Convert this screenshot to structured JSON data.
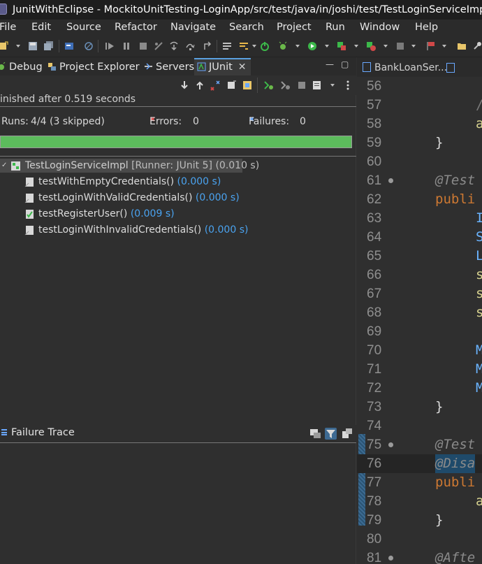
{
  "window": {
    "title": "JunitWithEclipse - MockitoUnitTesting-LoginApp/src/test/java/in/joshi/test/TestLoginServiceImpl.java -"
  },
  "menu": [
    "File",
    "Edit",
    "Source",
    "Refactor",
    "Navigate",
    "Search",
    "Project",
    "Run",
    "Window",
    "Help"
  ],
  "views": {
    "tabs": [
      {
        "label": "Debug",
        "icon": "debug-icon"
      },
      {
        "label": "Project Explorer",
        "icon": "project-explorer-icon"
      },
      {
        "label": "Servers",
        "icon": "servers-icon"
      },
      {
        "label": "JUnit",
        "icon": "junit-icon",
        "active": true
      }
    ]
  },
  "junit": {
    "status": "inished after 0.519 seconds",
    "runs_label": "Runs:",
    "runs_value": "4/4 (3 skipped)",
    "errors_label": "Errors:",
    "errors_value": "0",
    "failures_label": "Failures:",
    "failures_value": "0",
    "progress": 1.0,
    "progress_color": "#5cbb5c",
    "root": {
      "name": "TestLoginServiceImpl",
      "runner": "[Runner: JUnit 5] (0.010 s)"
    },
    "tests": [
      {
        "name": "testWithEmptyCredentials()",
        "time": "(0.000 s)",
        "status": "skipped"
      },
      {
        "name": "testLoginWithValidCredentials()",
        "time": "(0.000 s)",
        "status": "skipped"
      },
      {
        "name": "testRegisterUser()",
        "time": "(0.009 s)",
        "status": "passed"
      },
      {
        "name": "testLoginWithInvalidCredentials()",
        "time": "(0.000 s)",
        "status": "skipped"
      }
    ],
    "failure_trace_title": "Failure Trace"
  },
  "editor": {
    "tab_label": "BankLoanSer...",
    "lines": [
      {
        "n": "56",
        "code": ""
      },
      {
        "n": "57",
        "code": "/"
      },
      {
        "n": "58",
        "code": "a"
      },
      {
        "n": "59",
        "code": "}"
      },
      {
        "n": "60",
        "code": ""
      },
      {
        "n": "61",
        "code": "@Test",
        "bp": true
      },
      {
        "n": "62",
        "code": "publi"
      },
      {
        "n": "63",
        "code": "I"
      },
      {
        "n": "64",
        "code": "S"
      },
      {
        "n": "65",
        "code": "L"
      },
      {
        "n": "66",
        "code": "s"
      },
      {
        "n": "67",
        "code": "s"
      },
      {
        "n": "68",
        "code": "s"
      },
      {
        "n": "69",
        "code": ""
      },
      {
        "n": "70",
        "code": "M"
      },
      {
        "n": "71",
        "code": "M"
      },
      {
        "n": "72",
        "code": "M"
      },
      {
        "n": "73",
        "code": "}"
      },
      {
        "n": "74",
        "code": ""
      },
      {
        "n": "75",
        "code": "@Test",
        "bp": true
      },
      {
        "n": "76",
        "code": "@Disa"
      },
      {
        "n": "77",
        "code": "publi"
      },
      {
        "n": "78",
        "code": "a"
      },
      {
        "n": "79",
        "code": "}"
      },
      {
        "n": "80",
        "code": ""
      },
      {
        "n": "81",
        "code": "@Afte",
        "bp": true
      }
    ]
  }
}
